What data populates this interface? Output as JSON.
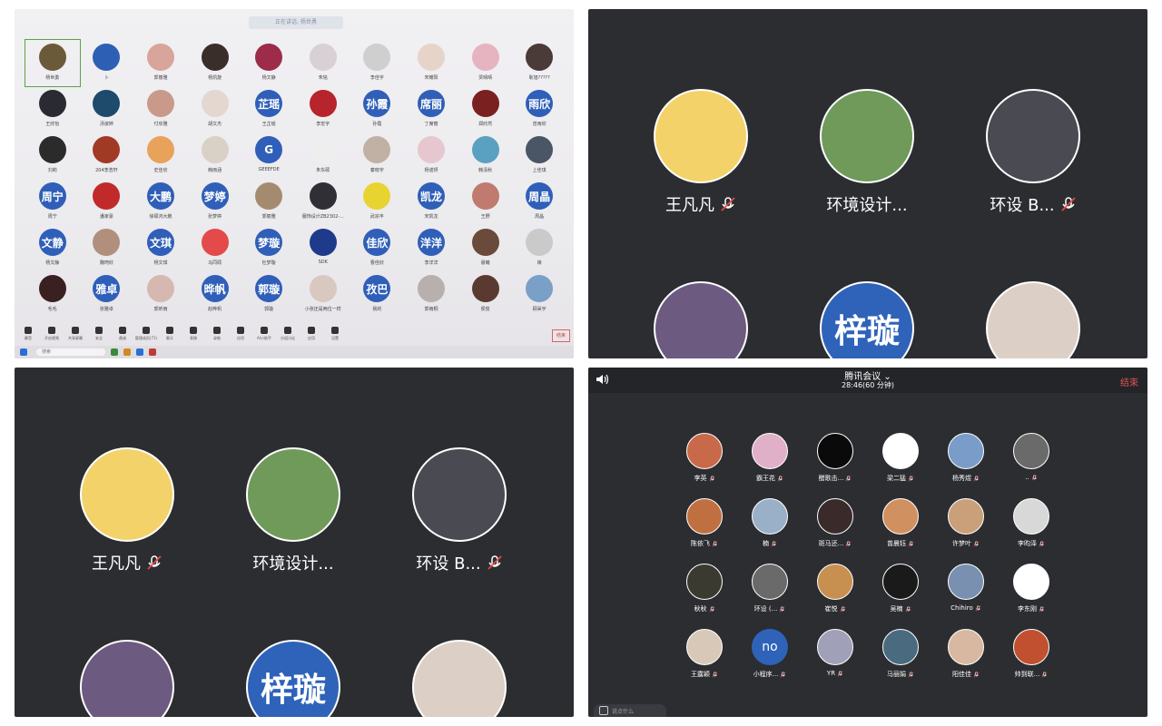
{
  "panel1": {
    "search_banner": "正在讲话: 杨世勇",
    "participants": [
      {
        "name": "杨世勇",
        "style": "photo",
        "color": "#6b5a3a",
        "selected": true
      },
      {
        "name": "卜",
        "style": "photo",
        "color": "#2d5fb5"
      },
      {
        "name": "郭丽雅",
        "style": "photo",
        "color": "#d7a59a"
      },
      {
        "name": "杨凯旋",
        "style": "photo",
        "color": "#3a2e2a"
      },
      {
        "name": "杨文静",
        "style": "photo",
        "color": "#9c2c4a"
      },
      {
        "name": "朱铭",
        "style": "photo",
        "color": "#d8d0d4"
      },
      {
        "name": "李佳宇",
        "style": "photo",
        "color": "#cfcfcf"
      },
      {
        "name": "宋耀阳",
        "style": "photo",
        "color": "#e7d4c8"
      },
      {
        "name": "贾晴晴",
        "style": "photo",
        "color": "#e6b3c0"
      },
      {
        "name": "耿旭?????",
        "style": "photo",
        "color": "#4a3a38"
      },
      {
        "name": "王欣怡",
        "style": "photo",
        "color": "#2a2a33"
      },
      {
        "name": "汤淑婷",
        "style": "photo",
        "color": "#1e4a6b"
      },
      {
        "name": "付欣雅",
        "style": "photo",
        "color": "#c99a8a"
      },
      {
        "name": "胡文杰",
        "style": "photo",
        "color": "#e4d7cf"
      },
      {
        "name": "王芷瑶",
        "style": "text",
        "label": "芷瑶"
      },
      {
        "name": "李宏宇",
        "style": "photo",
        "color": "#b8242c"
      },
      {
        "name": "孙霞",
        "style": "text",
        "label": "孙霞"
      },
      {
        "name": "丁席丽",
        "style": "text",
        "label": "席丽"
      },
      {
        "name": "郑欣然",
        "style": "photo",
        "color": "#7a2020"
      },
      {
        "name": "曾雨欣",
        "style": "text",
        "label": "雨欣"
      },
      {
        "name": "刘莉",
        "style": "photo",
        "color": "#2b2b2b"
      },
      {
        "name": "204李浩轩",
        "style": "photo",
        "color": "#a13a25"
      },
      {
        "name": "史佳欣",
        "style": "photo",
        "color": "#e8a25a"
      },
      {
        "name": "韩雨涵",
        "style": "photo",
        "color": "#d9d1c5"
      },
      {
        "name": "GEEEFDE",
        "style": "text",
        "label": "G"
      },
      {
        "name": "朱东硕",
        "style": "photo",
        "color": "#eeeeee"
      },
      {
        "name": "秦晓宇",
        "style": "photo",
        "color": "#c1b1a5"
      },
      {
        "name": "杨诺妍",
        "style": "photo",
        "color": "#e6c7cf"
      },
      {
        "name": "韩清秋",
        "style": "photo",
        "color": "#5aa0c0"
      },
      {
        "name": "上佳琪",
        "style": "photo",
        "color": "#4a5565"
      },
      {
        "name": "周宁",
        "style": "text",
        "label": "周宁"
      },
      {
        "name": "潘家豪",
        "style": "photo",
        "color": "#c02a2a"
      },
      {
        "name": "徐硕鸿大鹏",
        "style": "text",
        "label": "大鹏"
      },
      {
        "name": "张梦婷",
        "style": "text",
        "label": "梦婷"
      },
      {
        "name": "郭丽雅",
        "style": "photo",
        "color": "#a48b70"
      },
      {
        "name": "服饰设计ZB2302-...",
        "style": "photo",
        "color": "#2f2f35"
      },
      {
        "name": "武宗丰",
        "style": "photo",
        "color": "#e8d430"
      },
      {
        "name": "宋凯龙",
        "style": "text",
        "label": "凯龙"
      },
      {
        "name": "王野",
        "style": "photo",
        "color": "#c07a70"
      },
      {
        "name": "周晶",
        "style": "text",
        "label": "周晶"
      },
      {
        "name": "杨文静",
        "style": "text",
        "label": "文静"
      },
      {
        "name": "魏珂欣",
        "style": "photo",
        "color": "#b0907c"
      },
      {
        "name": "杨文琪",
        "style": "text",
        "label": "文琪"
      },
      {
        "name": "马同硕",
        "style": "photo",
        "color": "#e44a4a"
      },
      {
        "name": "杜梦璇",
        "style": "text",
        "label": "梦璇"
      },
      {
        "name": "SDK",
        "style": "photo",
        "color": "#1e3a8a"
      },
      {
        "name": "曹佳欣",
        "style": "text",
        "label": "佳欣"
      },
      {
        "name": "李洋洋",
        "style": "text",
        "label": "洋洋"
      },
      {
        "name": "晨曦",
        "style": "photo",
        "color": "#6a4a3a"
      },
      {
        "name": "婧",
        "style": "photo",
        "color": "#cacaca"
      },
      {
        "name": "毛毛",
        "style": "photo",
        "color": "#3a2020"
      },
      {
        "name": "张雅卓",
        "style": "text",
        "label": "雅卓"
      },
      {
        "name": "郭昕雨",
        "style": "photo",
        "color": "#d6b8b0"
      },
      {
        "name": "赵晔帆",
        "style": "text",
        "label": "晔帆"
      },
      {
        "name": "郭璇",
        "style": "text",
        "label": "郭璇"
      },
      {
        "name": "小张还是两位一样",
        "style": "photo",
        "color": "#d8c8c0"
      },
      {
        "name": "我的",
        "style": "text",
        "label": "孜巴"
      },
      {
        "name": "郭雨桐",
        "style": "photo",
        "color": "#b7b0ad"
      },
      {
        "name": "侯俊",
        "style": "photo",
        "color": "#5a3a30"
      },
      {
        "name": "顾昊宇",
        "style": "photo",
        "color": "#7aa0c8"
      }
    ],
    "toolbar": [
      {
        "label": "静音",
        "icon": "mic-icon"
      },
      {
        "label": "开启视频",
        "icon": "camera-icon"
      },
      {
        "label": "共享屏幕",
        "icon": "share-screen-icon"
      },
      {
        "label": "安全",
        "icon": "shield-icon"
      },
      {
        "label": "邀请",
        "icon": "invite-icon"
      },
      {
        "label": "管理成员(71)",
        "icon": "members-icon"
      },
      {
        "label": "聊天",
        "icon": "chat-icon"
      },
      {
        "label": "表情",
        "icon": "emoji-icon"
      },
      {
        "label": "录制",
        "icon": "record-icon"
      },
      {
        "label": "应用",
        "icon": "apps-icon"
      },
      {
        "label": "AI小助手",
        "icon": "ai-icon"
      },
      {
        "label": "分组讨论",
        "icon": "breakout-icon"
      },
      {
        "label": "应用",
        "icon": "apps2-icon"
      },
      {
        "label": "设置",
        "icon": "settings-icon"
      }
    ],
    "end_label": "结束",
    "taskbar_search": "搜索"
  },
  "panel2": {
    "tiles": [
      {
        "name": "王凡凡",
        "muted": true,
        "color": "#f3d26a"
      },
      {
        "name": "环境设计...",
        "muted": false,
        "color": "#6f9a5a"
      },
      {
        "name": "环设 B...",
        "muted": true,
        "color": "#4a4a52"
      }
    ],
    "bottom_row": [
      {
        "color": "#6d5a80"
      },
      {
        "label": "梓璇",
        "color": "#2f63b9"
      },
      {
        "color": "#dcd0c6"
      }
    ]
  },
  "panel3": {
    "tiles": [
      {
        "name": "王凡凡",
        "muted": true,
        "color": "#f3d26a"
      },
      {
        "name": "环境设计...",
        "muted": false,
        "color": "#6f9a5a"
      },
      {
        "name": "环设 B...",
        "muted": true,
        "color": "#4a4a52"
      }
    ],
    "bottom_row": [
      {
        "color": "#6d5a80"
      },
      {
        "label": "梓璇",
        "color": "#2f63b9"
      },
      {
        "color": "#dcd0c6"
      }
    ]
  },
  "panel4": {
    "title": "腾讯会议",
    "time": "28:46(60 分钟)",
    "end_label": "结束",
    "chat_placeholder": "说点什么",
    "participants": [
      {
        "name": "李英",
        "color": "#c86a4a"
      },
      {
        "name": "霸王花",
        "color": "#e0b0c8"
      },
      {
        "name": "醋歌击...",
        "color": "#0a0a0a"
      },
      {
        "name": "梁二猛",
        "color": "#ffffff"
      },
      {
        "name": "杨秀煜",
        "color": "#7a9cc8"
      },
      {
        "name": "..",
        "color": "#6a6a6a"
      },
      {
        "name": "陈依飞",
        "color": "#c07040"
      },
      {
        "name": "楠",
        "color": "#9ab0c8"
      },
      {
        "name": "斑马还...",
        "color": "#3a2a2a"
      },
      {
        "name": "曾晨钰",
        "color": "#d09060"
      },
      {
        "name": "许梦叶",
        "color": "#c9a07a"
      },
      {
        "name": "李昀泽",
        "color": "#d8d8d8"
      },
      {
        "name": "秋秋",
        "color": "#3a3a30"
      },
      {
        "name": "环设 (...",
        "color": "#6a6a6a"
      },
      {
        "name": "崔悦",
        "color": "#c89050"
      },
      {
        "name": "吴楠",
        "color": "#1a1a1a"
      },
      {
        "name": "Chihiro",
        "color": "#7a90b0"
      },
      {
        "name": "李东刚",
        "color": "#ffffff"
      },
      {
        "name": "王露颖",
        "color": "#d8c8b8"
      },
      {
        "name": "小程序...",
        "label": "no",
        "color": "#2f63b9"
      },
      {
        "name": "YR",
        "color": "#a0a0b8"
      },
      {
        "name": "马丽娟",
        "color": "#4a6a80"
      },
      {
        "name": "阳佳佳",
        "color": "#d8b8a0"
      },
      {
        "name": "帅到联...",
        "color": "#c05030"
      }
    ]
  }
}
